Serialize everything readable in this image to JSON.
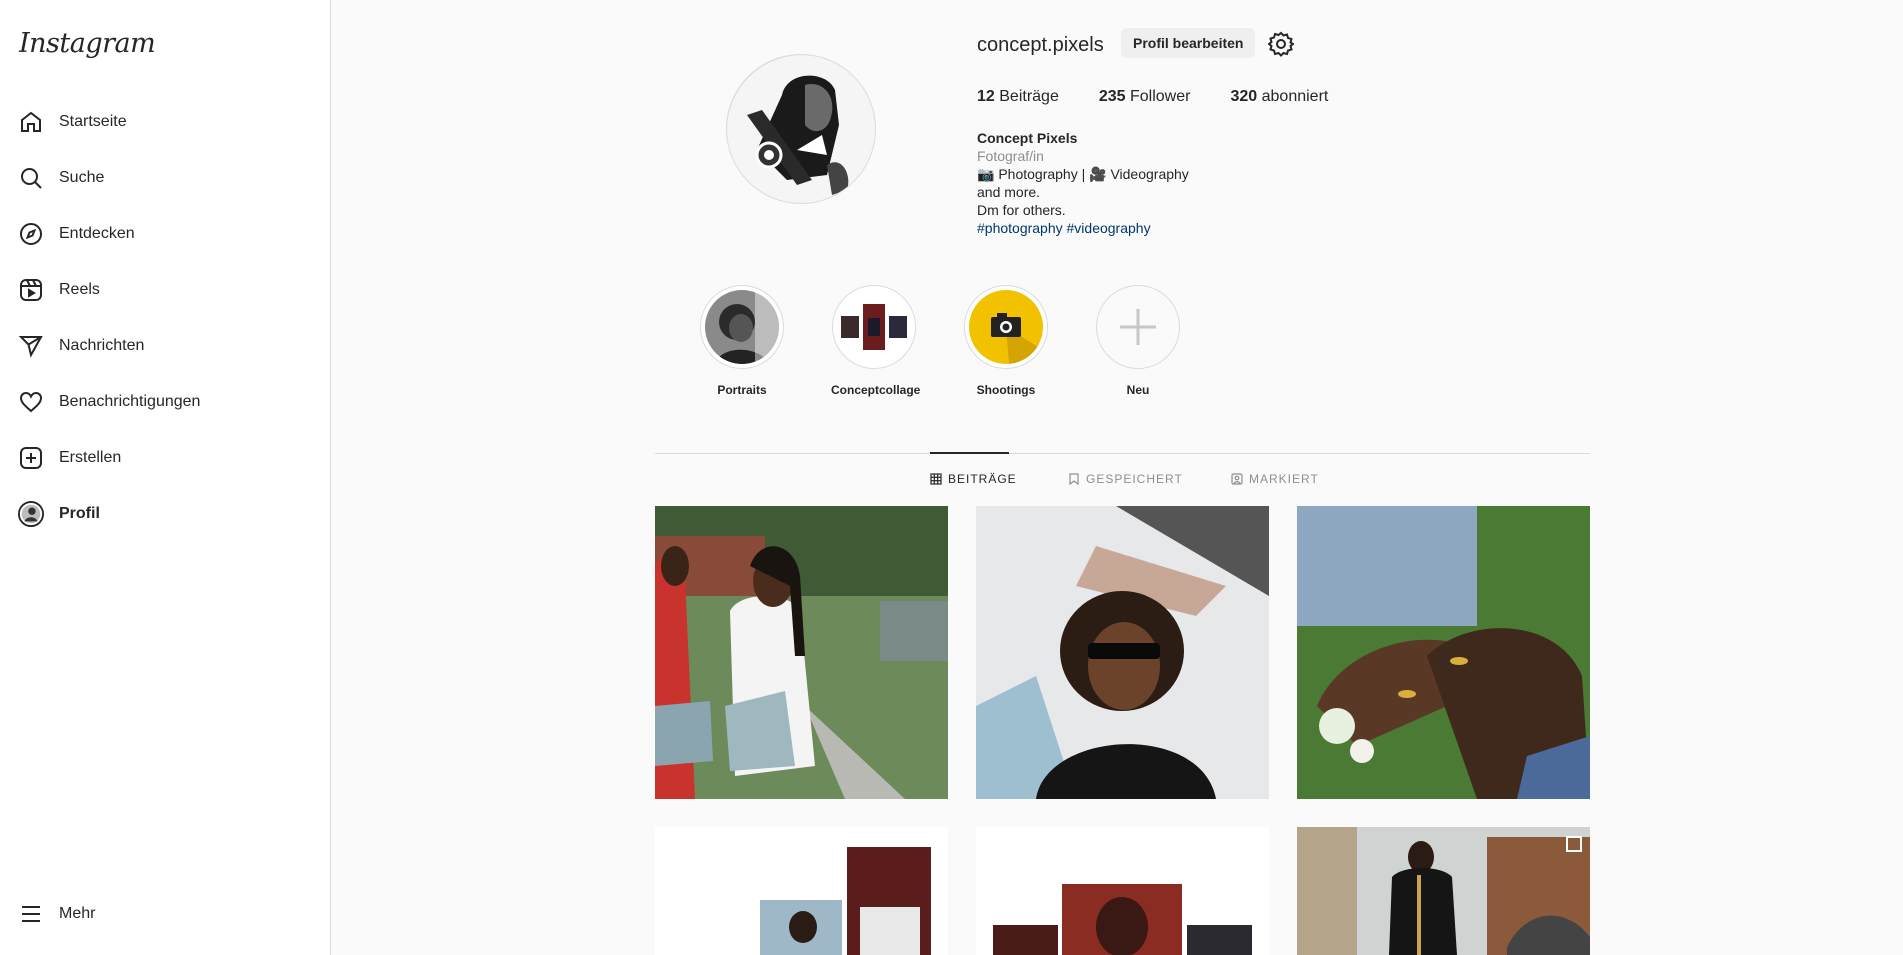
{
  "sidebar": {
    "logo": "Instagram",
    "items": [
      {
        "label": "Startseite",
        "icon": "home-icon"
      },
      {
        "label": "Suche",
        "icon": "search-icon"
      },
      {
        "label": "Entdecken",
        "icon": "compass-icon"
      },
      {
        "label": "Reels",
        "icon": "reels-icon"
      },
      {
        "label": "Nachrichten",
        "icon": "send-icon"
      },
      {
        "label": "Benachrichtigungen",
        "icon": "heart-icon"
      },
      {
        "label": "Erstellen",
        "icon": "plus-square-icon"
      },
      {
        "label": "Profil",
        "icon": "avatar"
      }
    ],
    "more_label": "Mehr"
  },
  "profile": {
    "username": "concept.pixels",
    "edit_label": "Profil bearbeiten",
    "posts_count": "12",
    "posts_label": "Beiträge",
    "followers_count": "235",
    "followers_label": "Follower",
    "following_count": "320",
    "following_label": "abonniert",
    "name": "Concept Pixels",
    "category": "Fotograf/in",
    "bio_line1": "📷 Photography | 🎥 Videography",
    "bio_line2": "and more.",
    "bio_line3": "Dm for others.",
    "bio_tags": "#photography #videography"
  },
  "highlights": [
    {
      "label": "Portraits"
    },
    {
      "label": "Conceptcollage"
    },
    {
      "label": "Shootings"
    },
    {
      "label": "Neu"
    }
  ],
  "tabs": {
    "posts": "BEITRÄGE",
    "saved": "GESPEICHERT",
    "tagged": "MARKIERT"
  }
}
